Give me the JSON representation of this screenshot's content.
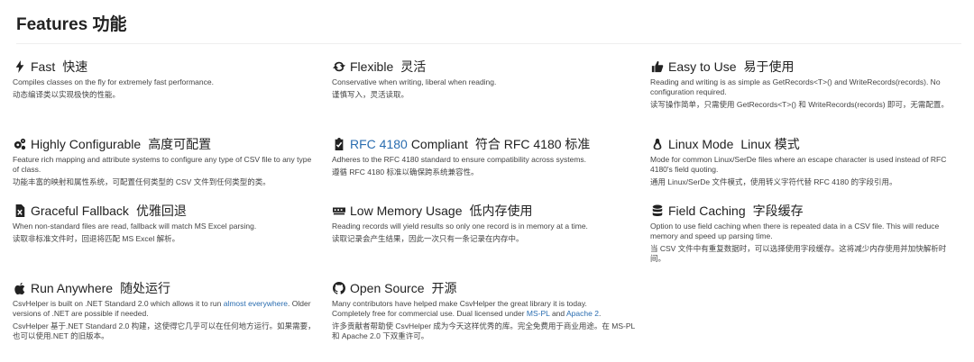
{
  "header": {
    "title": "Features  功能"
  },
  "features": [
    {
      "id": "fast",
      "icon": "bolt-icon",
      "title": "Fast",
      "title_cn": "快速",
      "desc": "Compiles classes on the fly for extremely fast performance.",
      "desc_cn": "动态编译类以实现极快的性能。"
    },
    {
      "id": "flexible",
      "icon": "refresh-icon",
      "title": "Flexible",
      "title_cn": "灵活",
      "desc": "Conservative when writing, liberal when reading.",
      "desc_cn": "谨慎写入，灵活读取。"
    },
    {
      "id": "easy",
      "icon": "thumbs-up-icon",
      "title": "Easy to Use",
      "title_cn": "易于使用",
      "desc": "Reading and writing is as simple as GetRecords<T>() and WriteRecords(records). No configuration required.",
      "desc_cn": "读写操作简单，只需使用 GetRecords<T>() 和 WriteRecords(records) 即可，无需配置。"
    },
    {
      "id": "configurable",
      "icon": "gears-icon",
      "title": "Highly Configurable",
      "title_cn": "高度可配置",
      "desc": "Feature rich mapping and attribute systems to configure any type of CSV file to any type of class.",
      "desc_cn": "功能丰富的映射和属性系统，可配置任何类型的 CSV 文件到任何类型的类。"
    },
    {
      "id": "rfc",
      "icon": "clipboard-check-icon",
      "title_link": "RFC 4180",
      "title_rest": "Compliant",
      "title_cn": "符合 RFC 4180 标准",
      "desc": "Adheres to the RFC 4180 standard to ensure compatibility across systems.",
      "desc_cn": "遵循 RFC 4180 标准以确保跨系统兼容性。"
    },
    {
      "id": "linux",
      "icon": "linux-icon",
      "title": "Linux Mode",
      "title_cn": "Linux 模式",
      "desc": "Mode for common Linux/SerDe files where an escape character is used instead of RFC 4180's field quoting.",
      "desc_cn": "通用 Linux/SerDe 文件模式，使用转义字符代替 RFC 4180 的字段引用。"
    },
    {
      "id": "fallback",
      "icon": "excel-icon",
      "title": "Graceful Fallback",
      "title_cn": "优雅回退",
      "desc": "When non-standard files are read, fallback will match MS Excel parsing.",
      "desc_cn": "读取非标准文件时，回退将匹配 MS Excel 解析。"
    },
    {
      "id": "memory",
      "icon": "memory-icon",
      "title": "Low Memory Usage",
      "title_cn": "低内存使用",
      "desc": "Reading records will yield results so only one record is in memory at a time.",
      "desc_cn": "读取记录会产生结果，因此一次只有一条记录在内存中。"
    },
    {
      "id": "caching",
      "icon": "database-icon",
      "title": "Field Caching",
      "title_cn": "字段缓存",
      "desc": "Option to use field caching when there is repeated data in a CSV file. This will reduce memory and speed up parsing time.",
      "desc_cn": "当 CSV 文件中有重复数据时，可以选择使用字段缓存。这将减少内存使用并加快解析时间。"
    },
    {
      "id": "anywhere",
      "icon": "apple-icon",
      "title": "Run Anywhere",
      "title_cn": "随处运行",
      "desc_pre": "CsvHelper is built on .NET Standard 2.0 which allows it to run ",
      "desc_link": "almost everywhere",
      "desc_post": ". Older versions of .NET are possible if needed.",
      "desc_cn": "CsvHelper 基于.NET Standard 2.0 构建，这使得它几乎可以在任何地方运行。如果需要，也可以使用.NET 的旧版本。"
    },
    {
      "id": "opensource",
      "icon": "github-icon",
      "title": "Open Source",
      "title_cn": "开源",
      "desc_line1": "Many contributors have helped make CsvHelper the great library it is today.",
      "desc_pre": "Completely free for commercial use. Dual licensed under ",
      "link1": "MS-PL",
      "and": " and ",
      "link2": "Apache 2",
      "period": ".",
      "desc_cn": "许多贡献者帮助使 CsvHelper 成为今天这样优秀的库。完全免费用于商业用途。在 MS-PL 和 Apache 2.0 下双重许可。"
    }
  ]
}
